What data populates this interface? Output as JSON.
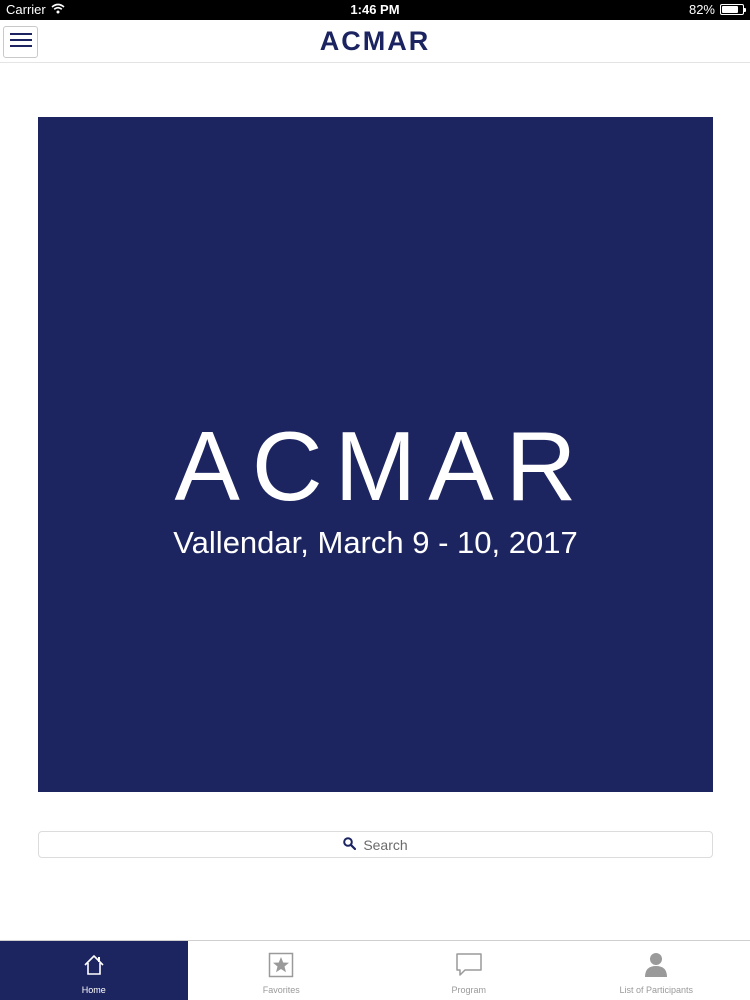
{
  "status_bar": {
    "carrier": "Carrier",
    "time": "1:46 PM",
    "battery_text": "82%",
    "battery_level": 0.82
  },
  "header": {
    "title": "ACMAR",
    "menu_icon": "hamburger-menu-icon"
  },
  "banner": {
    "title": "ACMAR",
    "subtitle": "Vallendar, March 9 - 10, 2017"
  },
  "search": {
    "placeholder": "Search",
    "icon": "search-icon"
  },
  "tabs": [
    {
      "label": "Home",
      "icon": "home-icon",
      "active": true
    },
    {
      "label": "Favorites",
      "icon": "star-icon",
      "active": false
    },
    {
      "label": "Program",
      "icon": "speech-bubble-icon",
      "active": false
    },
    {
      "label": "List of Participants",
      "icon": "person-icon",
      "active": false
    }
  ],
  "colors": {
    "brand": "#1d2561",
    "header_title": "#1b2461",
    "tab_inactive": "#9a9a9a"
  }
}
